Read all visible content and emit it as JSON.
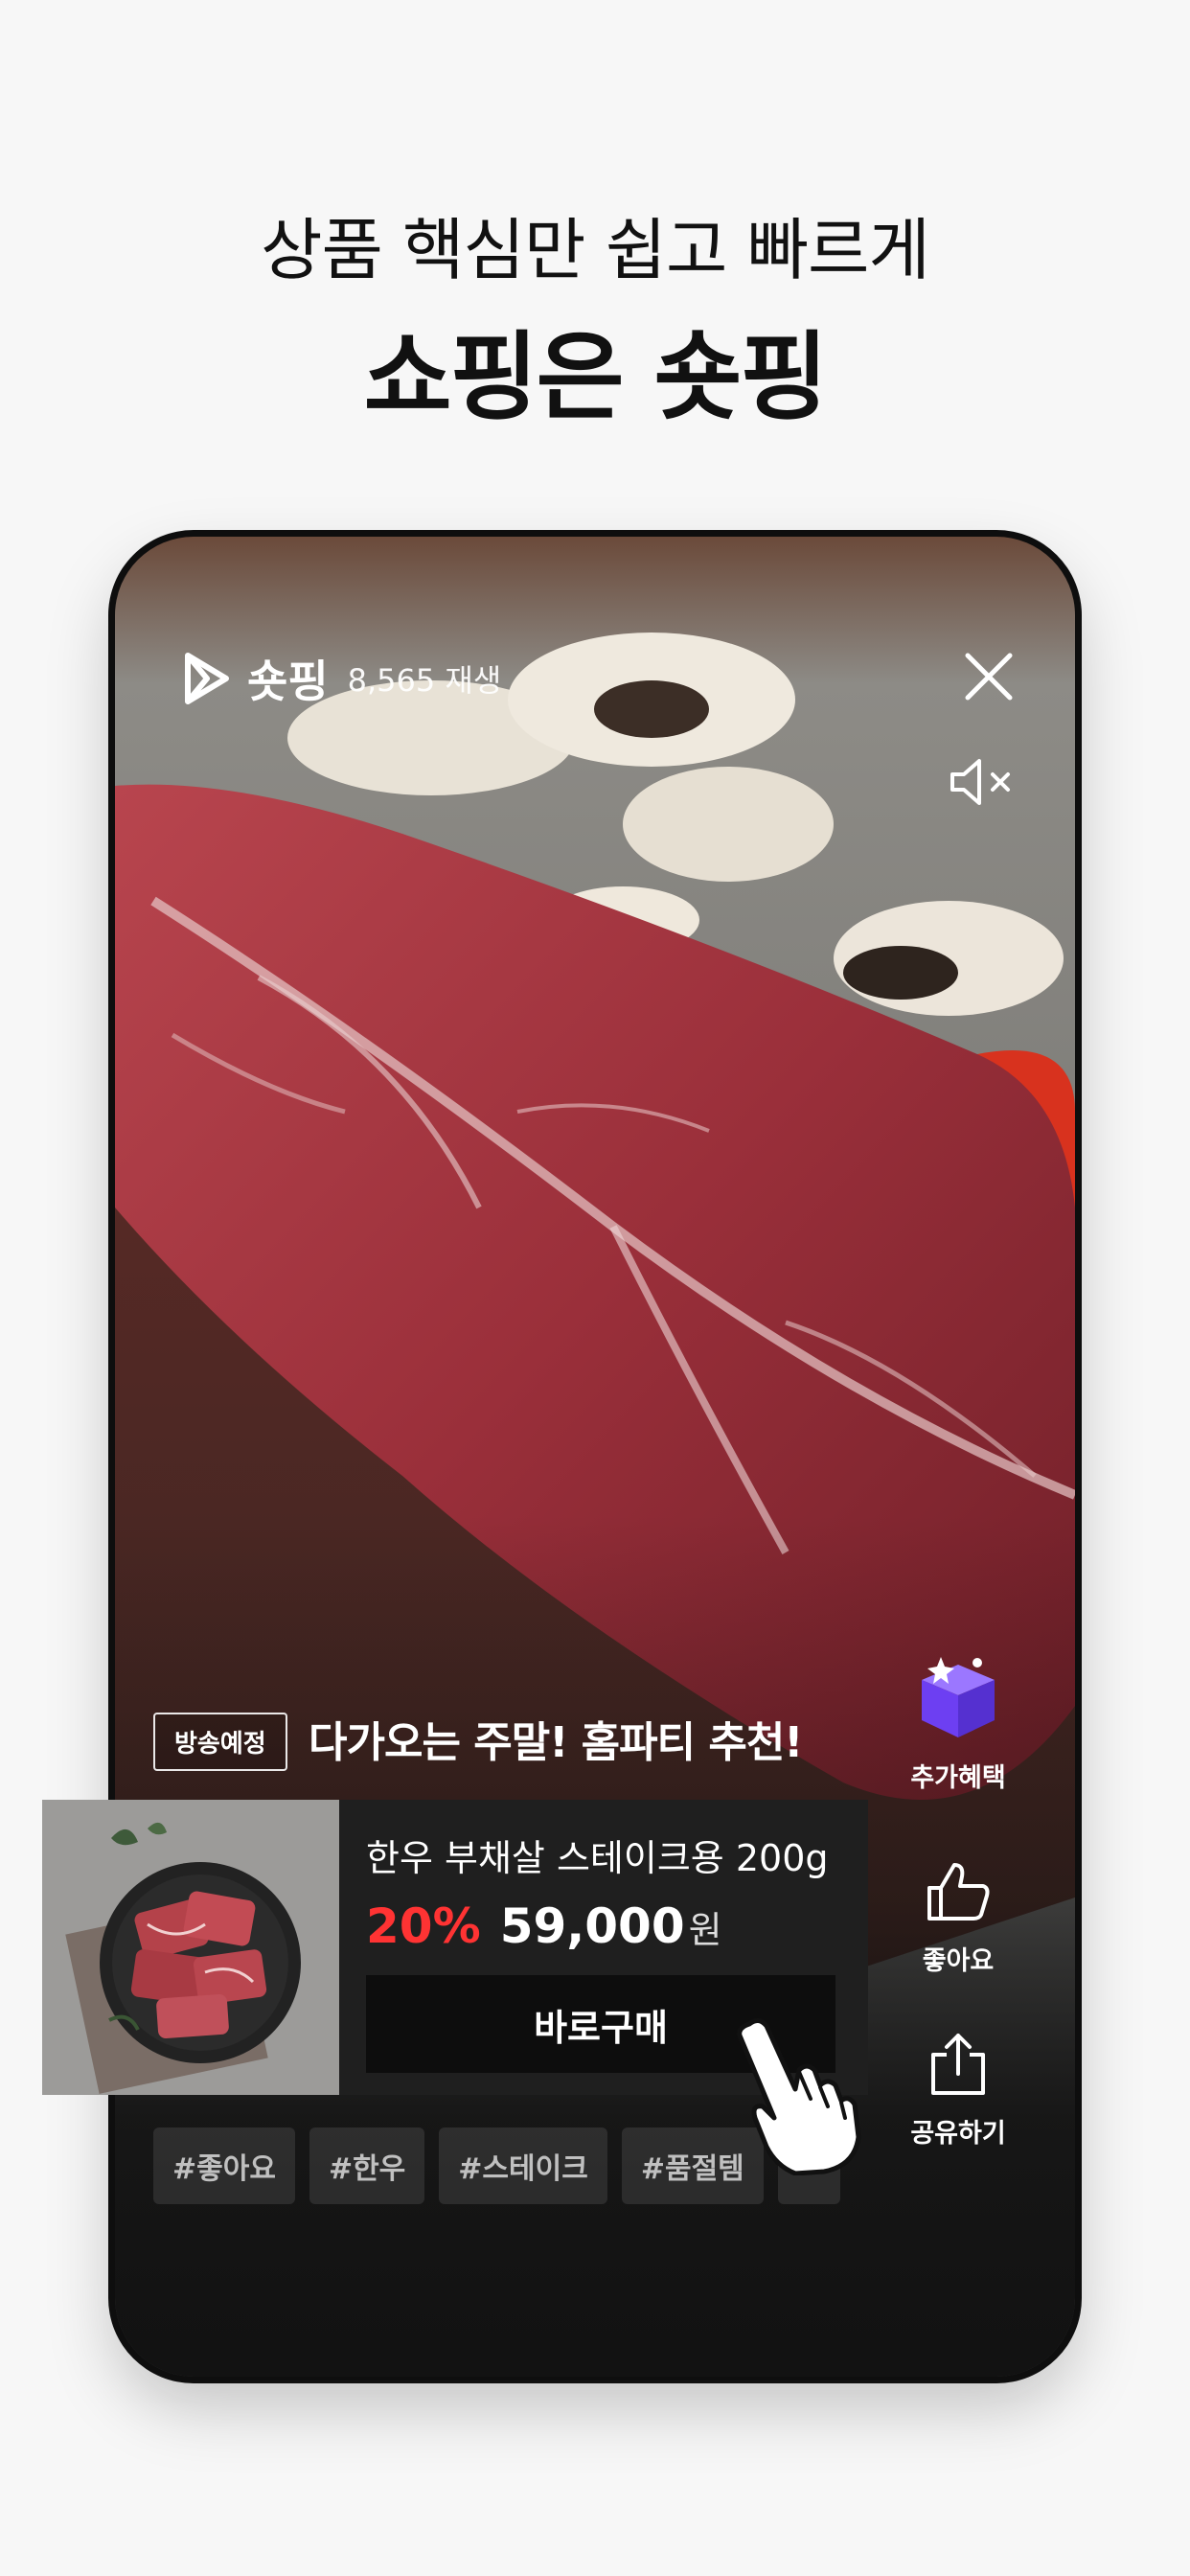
{
  "headline": {
    "subtitle": "상품 핵심만 쉽고 빠르게",
    "title": "쇼핑은 숏핑"
  },
  "player": {
    "brand": "숏핑",
    "views": "8,565 재생",
    "icons": {
      "logo": "play-triangle-icon",
      "close": "close-icon",
      "mute": "speaker-muted-icon"
    }
  },
  "broadcast": {
    "tag": "방송예정",
    "title": "다가오는 주말! 홈파티 추천!"
  },
  "side_actions": [
    {
      "label": "추가혜택",
      "icon": "gift-box-icon"
    },
    {
      "label": "좋아요",
      "icon": "thumbs-up-icon"
    },
    {
      "label": "공유하기",
      "icon": "share-icon"
    }
  ],
  "product": {
    "name": "한우 부채살 스테이크용 200g",
    "discount": "20%",
    "price": "59,000",
    "currency": "원",
    "buy_label": "바로구매"
  },
  "hashtags": [
    "#좋아요",
    "#한우",
    "#스테이크",
    "#품절템",
    "#"
  ],
  "colors": {
    "discount": "#ff3333",
    "page_background": "#f7f7f7",
    "gift_box": "#7b4dff"
  }
}
